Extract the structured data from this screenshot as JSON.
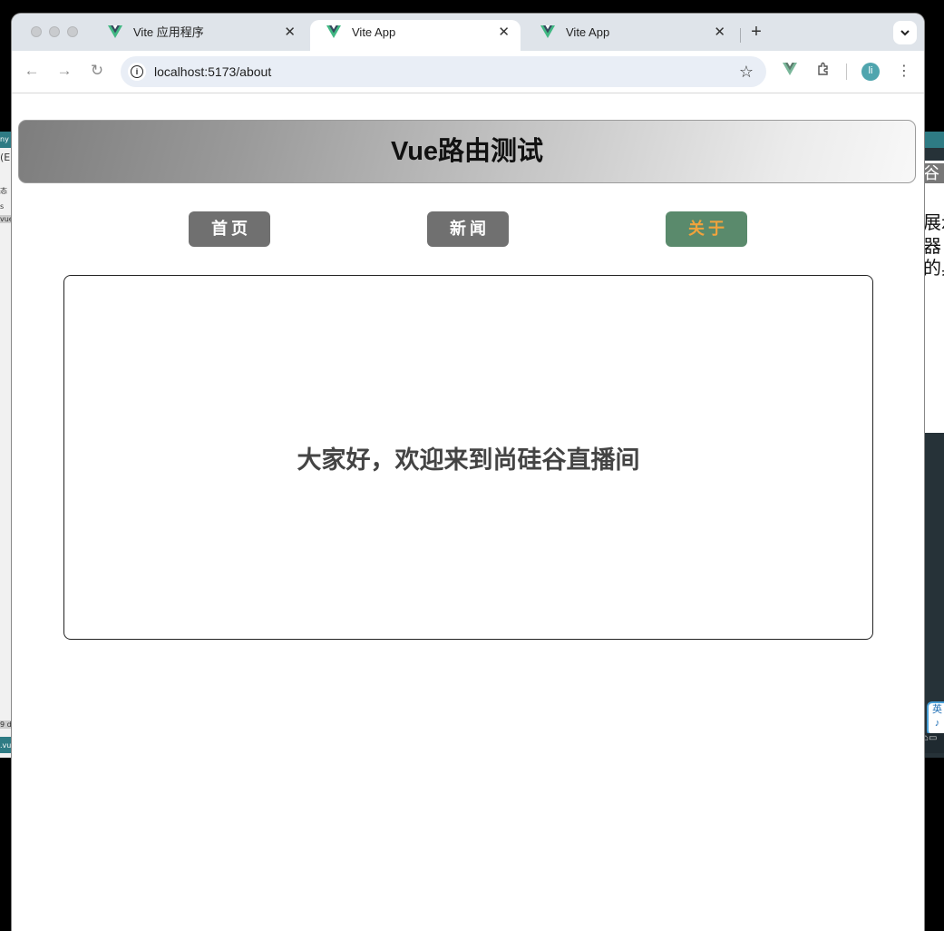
{
  "browser": {
    "tabs": [
      {
        "title": "Vite 应用程序",
        "active": false
      },
      {
        "title": "Vite App",
        "active": true
      },
      {
        "title": "Vite App",
        "active": false
      }
    ],
    "url": "localhost:5173/about",
    "profile_initial": "li"
  },
  "page": {
    "title": "Vue路由测试",
    "nav": [
      {
        "label": "首页",
        "active": false
      },
      {
        "label": "新闻",
        "active": false
      },
      {
        "label": "关于",
        "active": true
      }
    ],
    "content_message": "大家好，欢迎来到尚硅谷直播间"
  },
  "colors": {
    "nav_button": "#707070",
    "nav_active_bg": "#5a8a6c",
    "nav_active_text": "#f2a33c"
  }
}
